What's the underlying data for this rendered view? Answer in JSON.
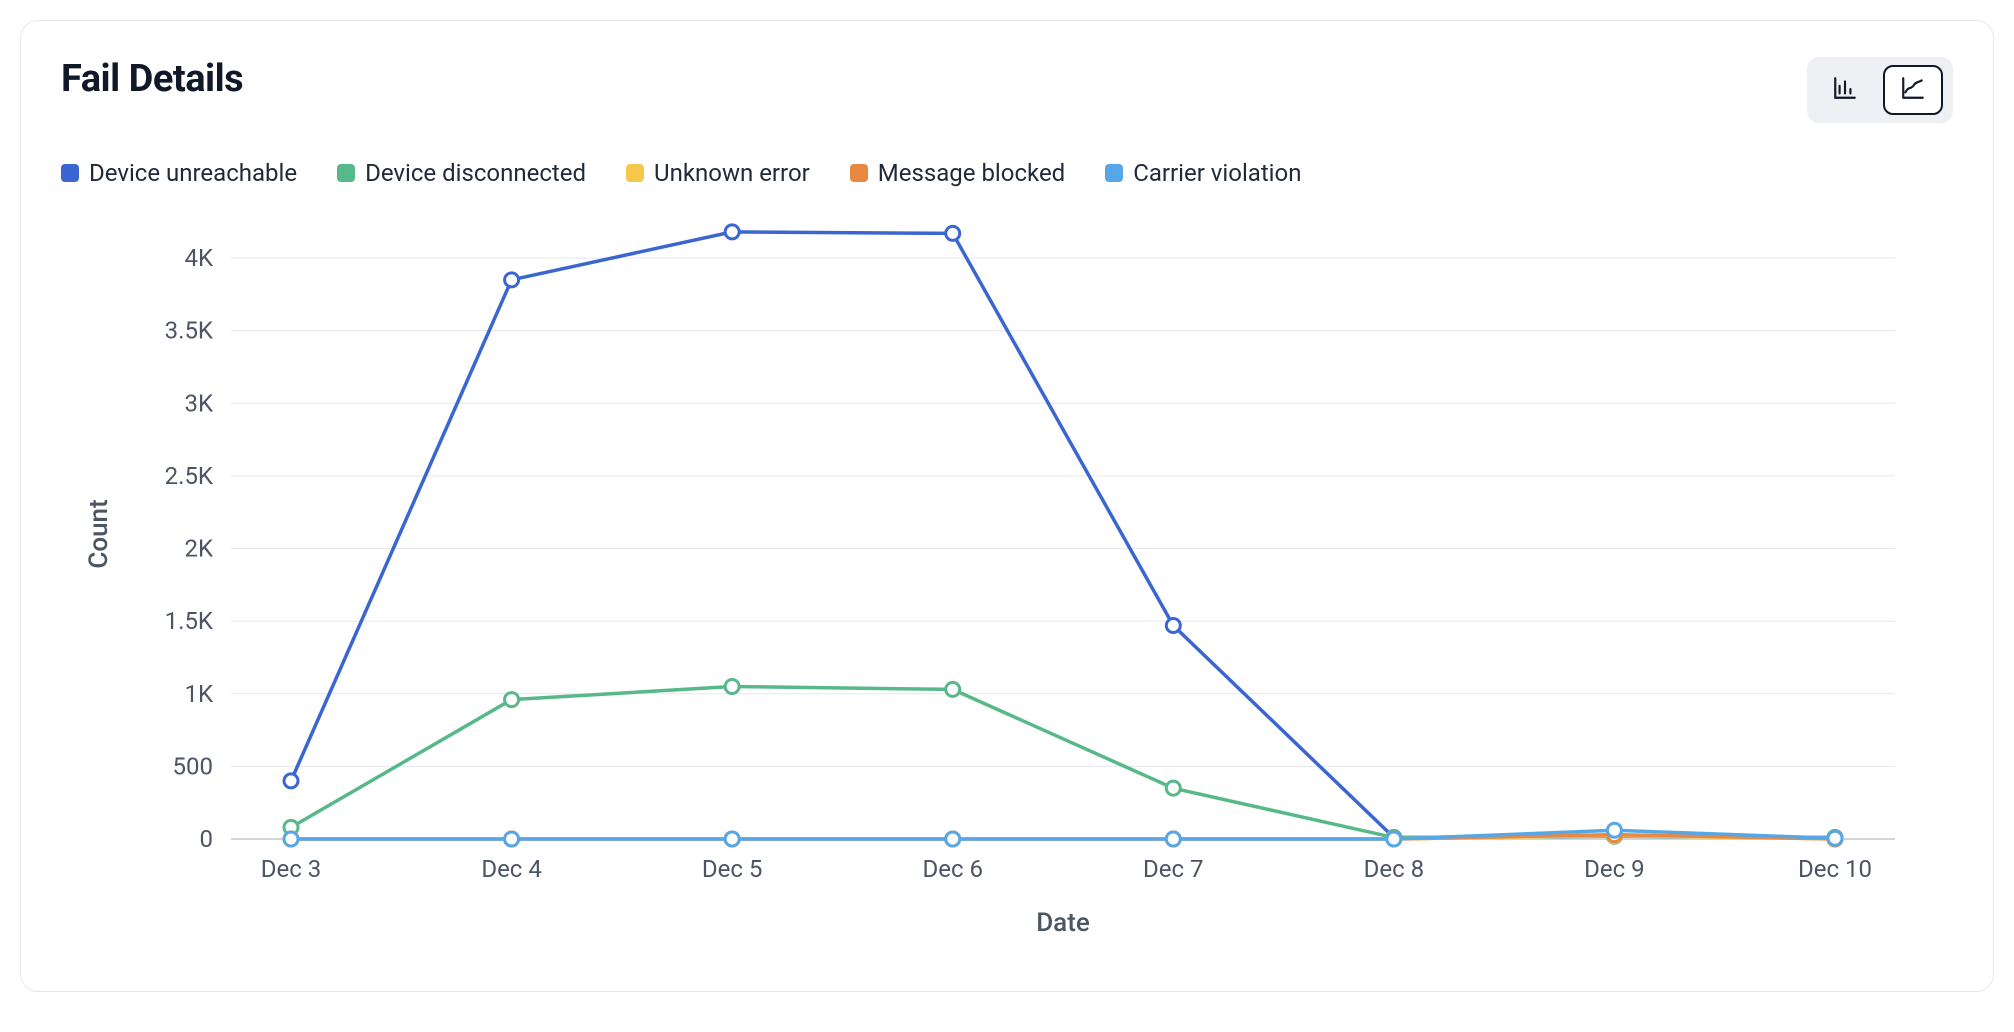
{
  "title": "Fail Details",
  "toggle": {
    "bar_icon": "bar-chart-icon",
    "line_icon": "line-chart-icon",
    "active": "line"
  },
  "chart_data": {
    "type": "line",
    "title": "Fail Details",
    "xlabel": "Date",
    "ylabel": "Count",
    "categories": [
      "Dec 3",
      "Dec 4",
      "Dec 5",
      "Dec 6",
      "Dec 7",
      "Dec 8",
      "Dec 9",
      "Dec 10"
    ],
    "yticks": [
      0,
      500,
      1000,
      1500,
      2000,
      2500,
      3000,
      3500,
      4000
    ],
    "ytick_labels": [
      "0",
      "500",
      "1K",
      "1.5K",
      "2K",
      "2.5K",
      "3K",
      "3.5K",
      "4K"
    ],
    "ylim": [
      0,
      4200
    ],
    "series": [
      {
        "name": "Device unreachable",
        "color": "#3b66d1",
        "values": [
          400,
          3850,
          4180,
          4170,
          1470,
          10,
          20,
          10
        ]
      },
      {
        "name": "Device disconnected",
        "color": "#57b88a",
        "values": [
          80,
          960,
          1050,
          1030,
          350,
          10,
          20,
          10
        ]
      },
      {
        "name": "Unknown error",
        "color": "#f5c84b",
        "values": [
          0,
          0,
          0,
          0,
          0,
          0,
          25,
          0
        ]
      },
      {
        "name": "Message blocked",
        "color": "#e8893f",
        "values": [
          0,
          0,
          0,
          0,
          0,
          0,
          30,
          0
        ]
      },
      {
        "name": "Carrier violation",
        "color": "#57a7e8",
        "values": [
          0,
          0,
          0,
          0,
          0,
          0,
          60,
          5
        ]
      }
    ],
    "legend_position": "top"
  }
}
